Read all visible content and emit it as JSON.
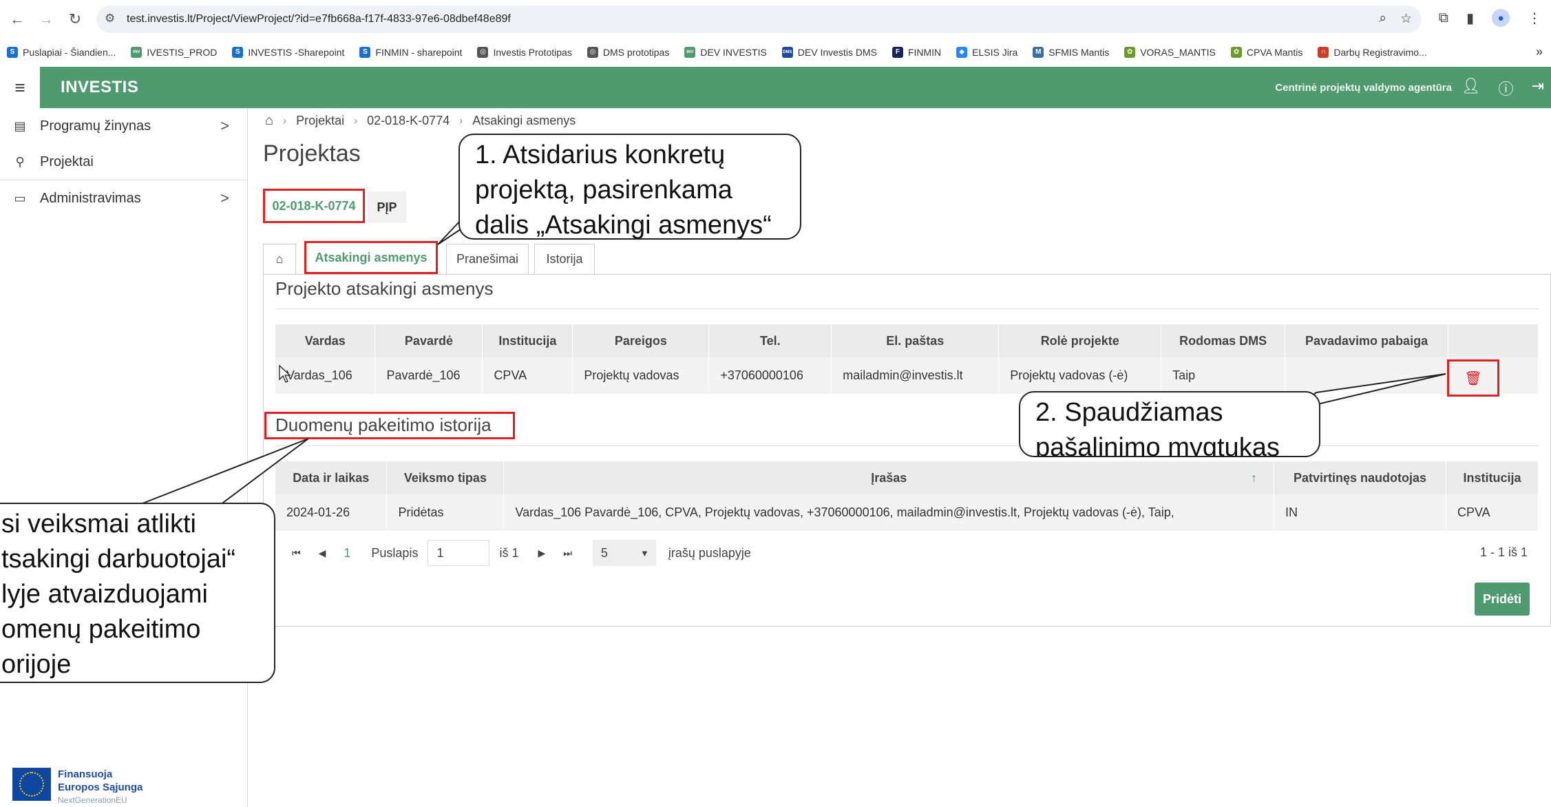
{
  "browser": {
    "url": "test.investis.lt/Project/ViewProject/?id=e7fb668a-f17f-4833-97e6-08dbef48e89f",
    "bookmarks": [
      {
        "label": "Puslapiai - Šiandien...",
        "color": "#1a6fcf",
        "icon": "S"
      },
      {
        "label": "IVESTIS_PROD",
        "color": "#4f9a6e",
        "icon": "INV"
      },
      {
        "label": "INVESTIS -Sharepoint",
        "color": "#1a6fcf",
        "icon": "S"
      },
      {
        "label": "FINMIN - sharepoint",
        "color": "#1a6fcf",
        "icon": "S"
      },
      {
        "label": "Investis Prototipas",
        "color": "#555555",
        "icon": "◎"
      },
      {
        "label": "DMS prototipas",
        "color": "#555555",
        "icon": "◎"
      },
      {
        "label": "DEV INVESTIS",
        "color": "#4f9a6e",
        "icon": "INV"
      },
      {
        "label": "DEV Investis DMS",
        "color": "#1f4b9e",
        "icon": "DMS"
      },
      {
        "label": "FINMIN",
        "color": "#13245e",
        "icon": "F"
      },
      {
        "label": "ELSIS Jira",
        "color": "#2684ff",
        "icon": "◆"
      },
      {
        "label": "SFMIS Mantis",
        "color": "#3a6ea5",
        "icon": "M"
      },
      {
        "label": "VORAS_MANTIS",
        "color": "#6a9b2a",
        "icon": "✿"
      },
      {
        "label": "CPVA Mantis",
        "color": "#6a9b2a",
        "icon": "✿"
      },
      {
        "label": "Darbų Registravimo...",
        "color": "#d23a2a",
        "icon": "∩"
      }
    ]
  },
  "app": {
    "brand": "INVESTIS",
    "agency": "Centrinė projektų valdymo agentūra"
  },
  "sidebar": {
    "items": [
      {
        "label": "Programų žinynas",
        "icon": "book-icon",
        "chevron": ">"
      },
      {
        "label": "Projektai",
        "icon": "sitemap-icon",
        "chevron": ""
      },
      {
        "label": "Administravimas",
        "icon": "desktop-icon",
        "chevron": ">"
      }
    ],
    "eu": {
      "line1": "Finansuoja",
      "line2": "Europos Sąjunga",
      "line3": "NextGenerationEU"
    }
  },
  "breadcrumb": [
    "Projektai",
    "02-018-K-0774",
    "Atsakingi asmenys"
  ],
  "page": {
    "title": "Projektas",
    "code": "02-018-K-0774",
    "type": "PĮP"
  },
  "tabs": [
    "Atsakingi asmenys",
    "Pranešimai",
    "Istorija"
  ],
  "responsible": {
    "title": "Projekto atsakingi asmenys",
    "headers": [
      "Vardas",
      "Pavardė",
      "Institucija",
      "Pareigos",
      "Tel.",
      "El. paštas",
      "Rolė projekte",
      "Rodomas DMS",
      "Pavadavimo pabaiga",
      ""
    ],
    "rows": [
      [
        "Vardas_106",
        "Pavardė_106",
        "CPVA",
        "Projektų vadovas",
        "+37060000106",
        "mailadmin@investis.lt",
        "Projektų vadovas (-ė)",
        "Taip",
        ""
      ]
    ]
  },
  "history": {
    "title": "Duomenų pakeitimo istorija",
    "headers": [
      "Data ir laikas",
      "Veiksmo tipas",
      "Įrašas",
      "Patvirtinęs naudotojas",
      "Institucija"
    ],
    "sort_indicator": "↑",
    "rows": [
      [
        "2024-01-26",
        "Pridėtas",
        "Vardas_106 Pavardė_106, CPVA, Projektų vadovas, +37060000106, mailadmin@investis.lt, Projektų vadovas (-ė), Taip,",
        "IN",
        "CPVA"
      ]
    ]
  },
  "pager": {
    "current_page": "1",
    "label_page": "Puslapis",
    "input_value": "1",
    "of_total": "iš 1",
    "per_page": "5",
    "per_page_label": "įrašų puslapyje",
    "count": "1 - 1 iš 1"
  },
  "buttons": {
    "add": "Pridėti"
  },
  "callouts": {
    "c1": [
      "1. Atsidarius konkretų",
      "projektą, pasirenkama",
      "dalis „Atsakingi asmenys“"
    ],
    "c2": [
      "2. Spaudžiamas",
      "pašalinimo mygtukas"
    ],
    "c3": [
      "si veiksmai atlikti",
      "tsakingi darbuotojai“",
      "lyje  atvaizduojami",
      "omenų pakeitimo",
      "orijoje"
    ]
  }
}
